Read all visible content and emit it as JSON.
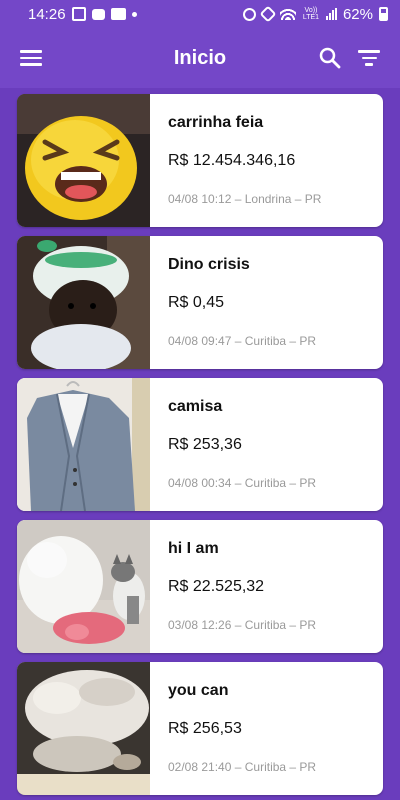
{
  "status_bar": {
    "time": "14:26",
    "battery": "62%",
    "volte_label": "Vo)) LTE1",
    "icons_left": [
      "image-icon",
      "chat-icon",
      "outlook-icon",
      "dot-icon"
    ],
    "icons_right": [
      "alarm-icon",
      "mute-icon",
      "wifi-icon",
      "volte-icon",
      "signal-icon",
      "battery-icon"
    ]
  },
  "app_bar": {
    "title": "Inicio",
    "menu_icon": "menu-icon",
    "search_icon": "search-icon",
    "filter_icon": "filter-icon",
    "color": "#7447c8"
  },
  "colors": {
    "background": "#6a3dbd",
    "card": "#ffffff",
    "meta_text": "#9a9a9a"
  },
  "listings": [
    {
      "title": "carrinha feia",
      "price": "R$ 12.454.346,16",
      "meta": "04/08 10:12 – Londrina – PR",
      "image": "crying-emoji-plush-photo"
    },
    {
      "title": "Dino crisis",
      "price": "R$ 0,45",
      "meta": "04/08 09:47 – Curitiba – PR",
      "image": "puppy-in-dinosaur-hat-photo"
    },
    {
      "title": "camisa",
      "price": "R$ 253,36",
      "meta": "04/08 00:34 – Curitiba – PR",
      "image": "gray-blazer-on-hanger-photo"
    },
    {
      "title": "hi I am",
      "price": "R$ 22.525,32",
      "meta": "03/08 12:26 – Curitiba – PR",
      "image": "white-dog-and-kitten-photo"
    },
    {
      "title": "you can",
      "price": "R$ 256,53",
      "meta": "02/08 21:40 – Curitiba – PR",
      "image": "sleeping-white-dog-photo"
    }
  ]
}
